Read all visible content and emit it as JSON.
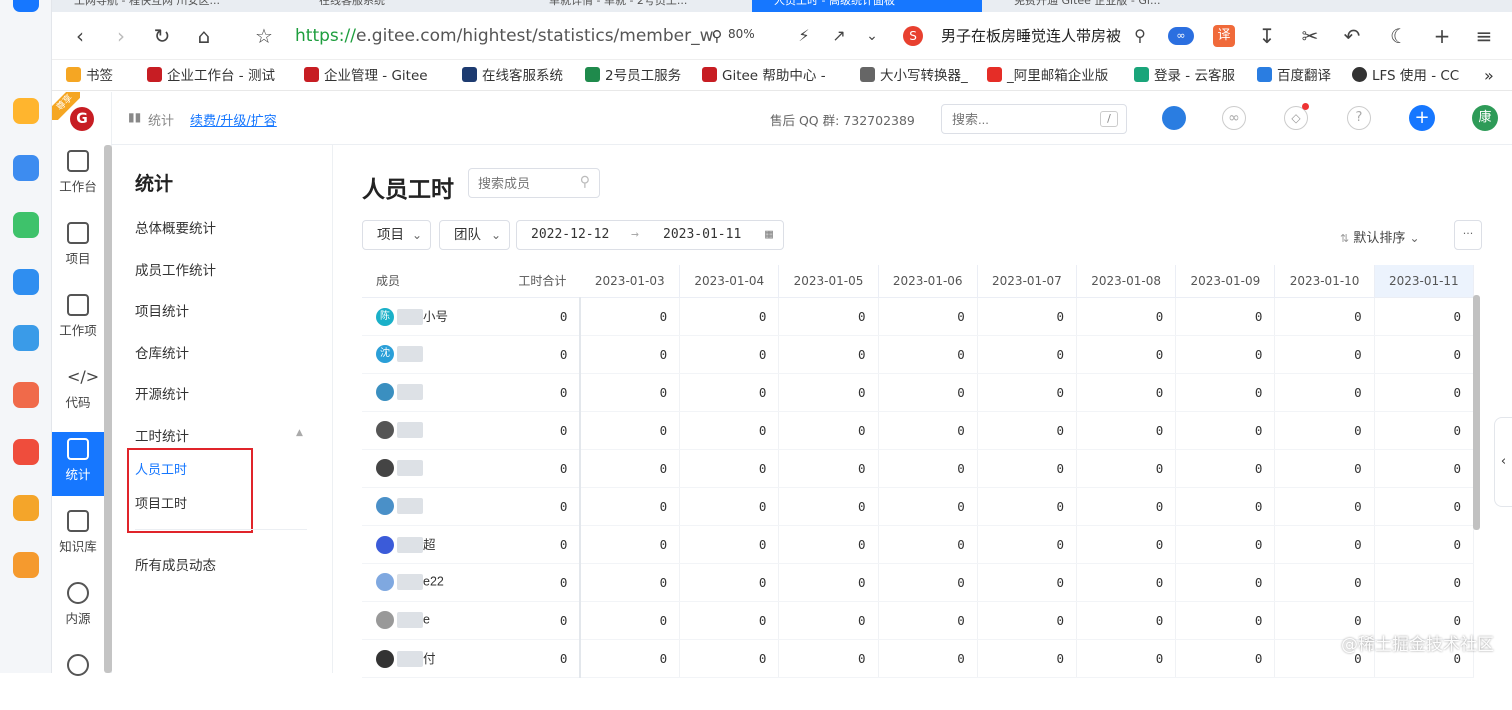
{
  "browser": {
    "tabs": [
      "工网导航 - 程快互网 川安区...",
      "在线客服系统",
      "单就详情 - 单就 - 2号员工...",
      "人员工时 - 高级统计面板",
      "免费开通 Gitee 企业版 - Gi..."
    ],
    "url_scheme": "https://",
    "url_rest": "e.gitee.com/hightest/statistics/member_work",
    "zoom": "80%",
    "news": "男子在板房睡觉连人带房被"
  },
  "bookmarks": [
    "书签",
    "企业工作台 - 测试",
    "企业管理 - Gitee",
    "在线客服系统",
    "2号员工服务",
    "Gitee 帮助中心 -",
    "大小写转换器_",
    "_阿里邮箱企业版",
    "登录 - 云客服",
    "百度翻译",
    "LFS 使用 - CC"
  ],
  "app_nav": [
    {
      "label": "工作台"
    },
    {
      "label": "项目"
    },
    {
      "label": "工作项"
    },
    {
      "label": "代码"
    },
    {
      "label": "统计"
    },
    {
      "label": "知识库"
    },
    {
      "label": "内源"
    }
  ],
  "logo_badge": "尊享",
  "header": {
    "crumb": "统计",
    "renew": "续费/升级/扩容",
    "qq": "售后 QQ 群: 732702389",
    "search_placeholder": "搜索...",
    "search_key": "/",
    "avatar": "康"
  },
  "sidebar": {
    "title": "统计",
    "items": [
      "总体概要统计",
      "成员工作统计",
      "项目统计",
      "仓库统计",
      "开源统计",
      "工时统计"
    ],
    "sub": [
      "人员工时",
      "项目工时"
    ],
    "footer": "所有成员动态"
  },
  "main": {
    "title": "人员工时",
    "member_search_placeholder": "搜索成员",
    "project": "项目",
    "team": "团队",
    "date_from": "2022-12-12",
    "date_to": "2023-01-11",
    "arrow": "→",
    "sort": "默认排序",
    "more": "···"
  },
  "table": {
    "member_header": "成员",
    "sum_header": "工时合计",
    "dates": [
      "2023-01-03",
      "2023-01-04",
      "2023-01-05",
      "2023-01-06",
      "2023-01-07",
      "2023-01-08",
      "2023-01-09",
      "2023-01-10",
      "2023-01-11"
    ],
    "rows": [
      {
        "avatar": "陈",
        "name": "小号",
        "color": "#1ab0c8"
      },
      {
        "avatar": "沈",
        "name": "",
        "color": "#2a9fd8"
      },
      {
        "avatar": "",
        "name": "",
        "color": "#3a8fc0"
      },
      {
        "avatar": "",
        "name": "",
        "color": "#555555"
      },
      {
        "avatar": "",
        "name": "",
        "color": "#444444"
      },
      {
        "avatar": "",
        "name": "",
        "color": "#4a90c8"
      },
      {
        "avatar": "",
        "name": "超",
        "color": "#3b5bd9"
      },
      {
        "avatar": "",
        "name": "e22",
        "color": "#7fa8e0"
      },
      {
        "avatar": "",
        "name": "e",
        "color": "#999999"
      },
      {
        "avatar": "",
        "name": "付",
        "color": "#333333"
      }
    ],
    "value": "0"
  },
  "watermark": "@稀土掘金技术社区"
}
